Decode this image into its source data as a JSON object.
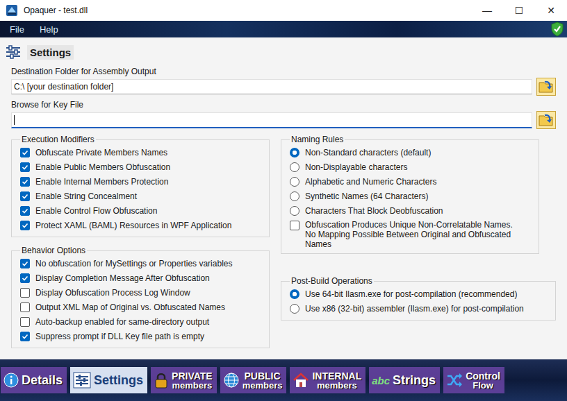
{
  "window": {
    "title": "Opaquer - test.dll",
    "controls": [
      "—",
      "☐",
      "✕"
    ]
  },
  "menu": [
    "File",
    "Help"
  ],
  "header": {
    "title": "Settings"
  },
  "fields": [
    {
      "label": "Destination Folder for Assembly Output",
      "value": "C:\\ [your destination folder]",
      "focused": false
    },
    {
      "label": "Browse for Key File",
      "value": "",
      "focused": true
    }
  ],
  "execution_modifiers": {
    "title": "Execution Modifiers",
    "items": [
      {
        "label": "Obfuscate  Private Members Names",
        "checked": true
      },
      {
        "label": "Enable Public Members Obfuscation",
        "checked": true
      },
      {
        "label": "Enable Internal Members Protection",
        "checked": true
      },
      {
        "label": "Enable String Concealment",
        "checked": true
      },
      {
        "label": "Enable Control Flow Obfuscation",
        "checked": true
      },
      {
        "label": "Protect XAML (BAML) Resources in WPF Application",
        "checked": true
      }
    ]
  },
  "behavior_options": {
    "title": "Behavior Options",
    "items": [
      {
        "label": "No obfuscation for MySettings or Properties variables",
        "checked": true
      },
      {
        "label": "Display Completion Message After Obfuscation",
        "checked": true
      },
      {
        "label": "Display Obfuscation Process Log Window",
        "checked": false
      },
      {
        "label": "Output XML Map of Original vs. Obfuscated Names",
        "checked": false
      },
      {
        "label": "Auto-backup enabled for same-directory output",
        "checked": false
      },
      {
        "label": "Suppress prompt if DLL Key file path is empty",
        "checked": true
      }
    ]
  },
  "naming_rules": {
    "title": "Naming Rules",
    "options": [
      {
        "label": "Non-Standard characters (default)",
        "selected": true
      },
      {
        "label": "Non-Displayable characters",
        "selected": false
      },
      {
        "label": "Alphabetic and Numeric Characters",
        "selected": false
      },
      {
        "label": "Synthetic Names (64 Characters)",
        "selected": false
      },
      {
        "label": "Characters That Block Deobfuscation",
        "selected": false
      }
    ],
    "unique_names": {
      "lines": [
        "Obfuscation Produces Unique Non-Correlatable Names.",
        "No Mapping Possible Between Original and Obfuscated",
        "Names"
      ],
      "checked": false
    }
  },
  "post_build": {
    "title": "Post-Build Operations",
    "options": [
      {
        "label": "Use 64-bit Ilasm.exe for post-compilation (recommended)",
        "selected": true
      },
      {
        "label": "Use x86 (32-bit) assembler (Ilasm.exe) for post-compilation",
        "selected": false
      }
    ]
  },
  "tabs": [
    {
      "kind": "info",
      "lines": [
        "Details"
      ],
      "selected": false,
      "icon_text": ""
    },
    {
      "kind": "settings",
      "lines": [
        "Settings"
      ],
      "selected": true,
      "icon_text": ""
    },
    {
      "kind": "lock",
      "lines": [
        "PRIVATE",
        "members"
      ],
      "selected": false,
      "icon_text": ""
    },
    {
      "kind": "globe",
      "lines": [
        "PUBLIC",
        "members"
      ],
      "selected": false,
      "icon_text": ""
    },
    {
      "kind": "house",
      "lines": [
        "INTERNAL",
        "members"
      ],
      "selected": false,
      "icon_text": ""
    },
    {
      "kind": "abc",
      "lines": [
        "Strings"
      ],
      "selected": false,
      "icon_text": "abc"
    },
    {
      "kind": "shuffle",
      "lines": [
        "Control",
        "Flow"
      ],
      "selected": false,
      "icon_text": ""
    }
  ]
}
